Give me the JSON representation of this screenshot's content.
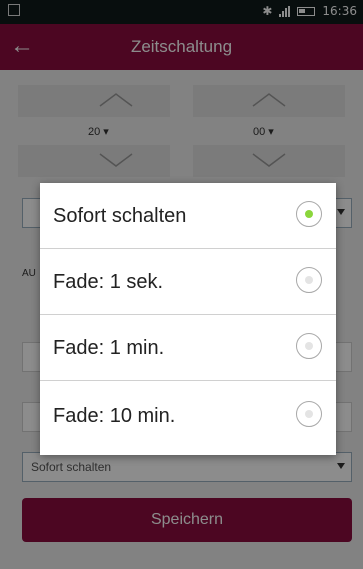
{
  "status": {
    "time": "16:36"
  },
  "header": {
    "title": "Zeitschaltung"
  },
  "picker": {
    "hour": "20",
    "minute": "00"
  },
  "labels": {
    "au_prefix": "AU"
  },
  "fade_select": {
    "value": "Sofort schalten"
  },
  "dialog": {
    "options": [
      {
        "label": "Sofort schalten",
        "selected": true
      },
      {
        "label": "Fade: 1 sek.",
        "selected": false
      },
      {
        "label": "Fade: 1 min.",
        "selected": false
      },
      {
        "label": "Fade: 10 min.",
        "selected": false
      }
    ]
  },
  "buttons": {
    "save": "Speichern"
  },
  "colors": {
    "brand": "#8a0c3e",
    "radio_selected": "#8bd63c"
  }
}
